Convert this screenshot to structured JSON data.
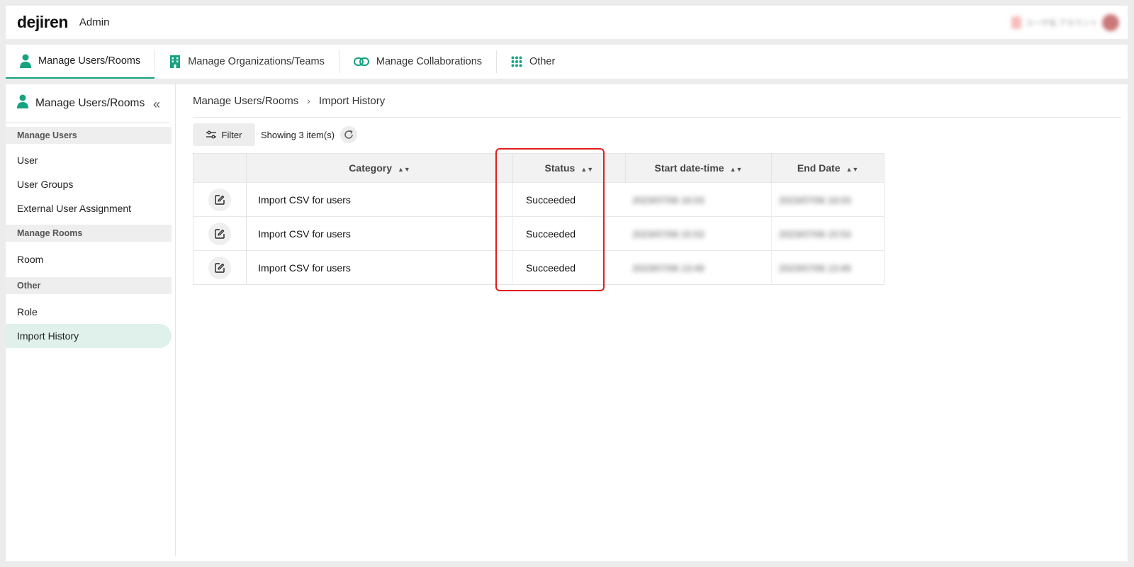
{
  "header": {
    "logo": "dejiren",
    "admin_label": "Admin",
    "user_info_blurred": "ユーザ名 アカウント"
  },
  "nav": {
    "tabs": [
      {
        "label": "Manage Users/Rooms",
        "icon": "person-icon",
        "active": true
      },
      {
        "label": "Manage Organizations/Teams",
        "icon": "building-icon",
        "active": false
      },
      {
        "label": "Manage Collaborations",
        "icon": "link-icon",
        "active": false
      },
      {
        "label": "Other",
        "icon": "grid-icon",
        "active": false
      }
    ]
  },
  "sidebar": {
    "title": "Manage Users/Rooms",
    "sections": [
      {
        "label": "Manage Users",
        "items": [
          "User",
          "User Groups",
          "External User Assignment"
        ]
      },
      {
        "label": "Manage Rooms",
        "items": [
          "Room"
        ]
      },
      {
        "label": "Other",
        "items": [
          "Role",
          "Import History"
        ]
      }
    ],
    "active_item": "Import History"
  },
  "breadcrumb": {
    "parent": "Manage Users/Rooms",
    "separator": "›",
    "current": "Import History"
  },
  "toolbar": {
    "filter_label": "Filter",
    "count_text": "Showing 3 item(s)"
  },
  "table": {
    "columns": [
      "Category",
      "Status",
      "Start date-time",
      "End Date"
    ],
    "rows": [
      {
        "category": "Import CSV for users",
        "status": "Succeeded",
        "start": "2023/07/06 16:03",
        "end": "2023/07/06 16:03"
      },
      {
        "category": "Import CSV for users",
        "status": "Succeeded",
        "start": "2023/07/06 15:53",
        "end": "2023/07/06 15:53"
      },
      {
        "category": "Import CSV for users",
        "status": "Succeeded",
        "start": "2023/07/06 13:49",
        "end": "2023/07/06 13:49"
      }
    ]
  },
  "colors": {
    "accent": "#16a37f",
    "highlight": "#e11d1d"
  }
}
